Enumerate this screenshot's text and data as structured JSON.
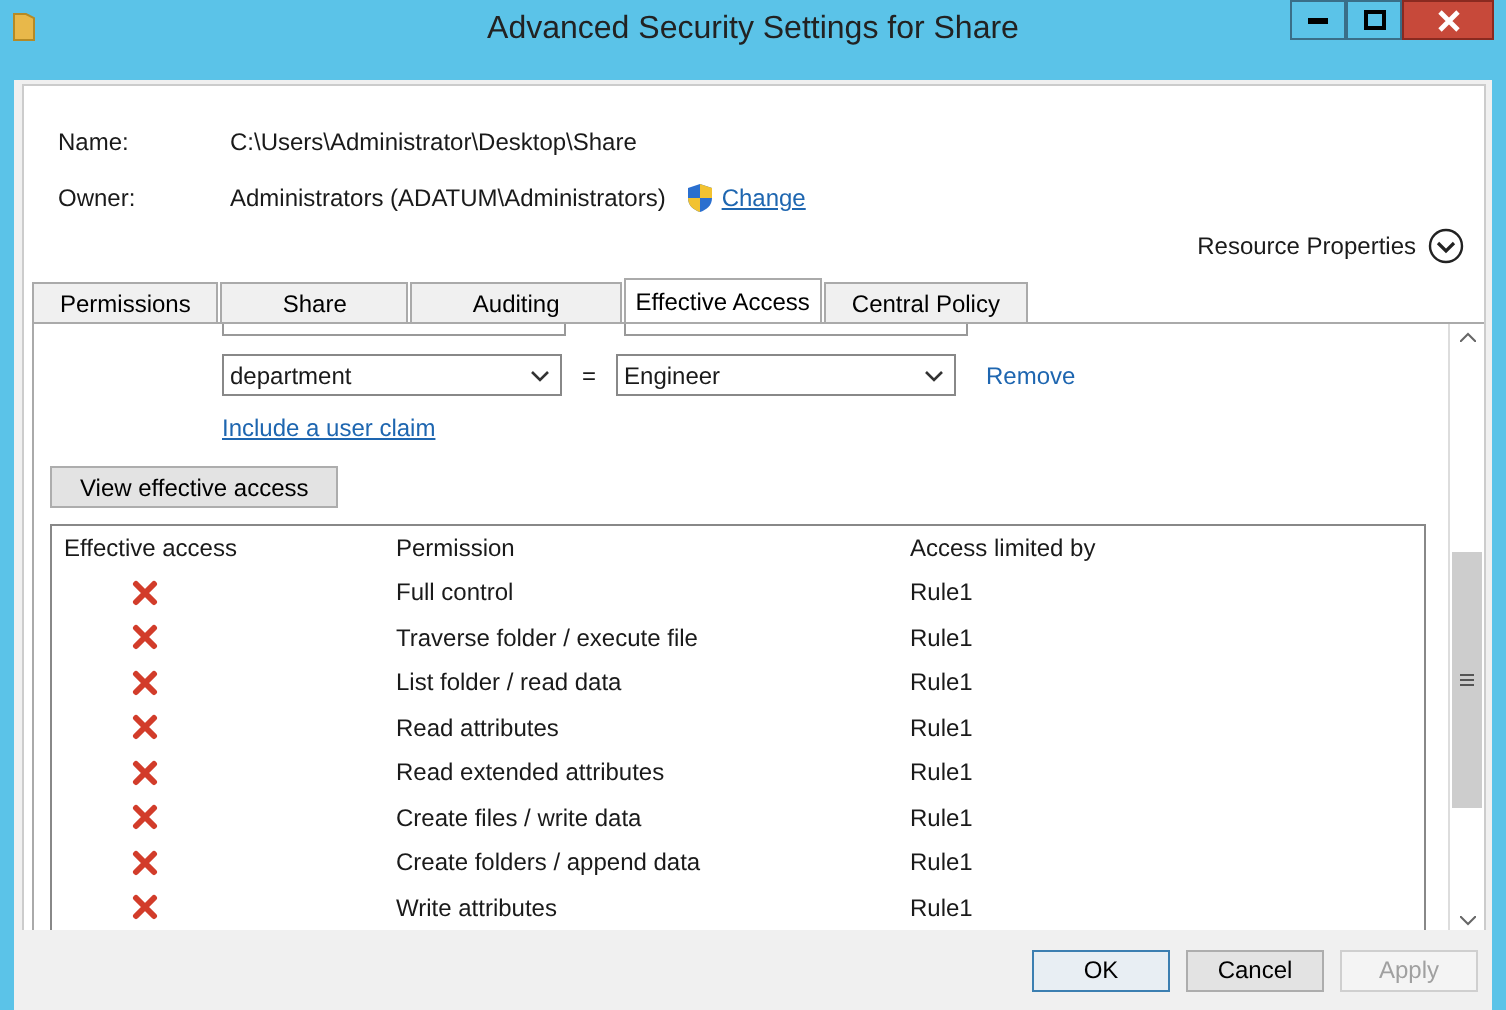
{
  "window": {
    "title": "Advanced Security Settings for Share"
  },
  "details": {
    "name_label": "Name:",
    "name_value": "C:\\Users\\Administrator\\Desktop\\Share",
    "owner_label": "Owner:",
    "owner_value": "Administrators (ADATUM\\Administrators)",
    "change_link": "Change",
    "resource_properties": "Resource Properties"
  },
  "tabs": [
    {
      "label": "Permissions",
      "selected": false
    },
    {
      "label": "Share",
      "selected": false
    },
    {
      "label": "Auditing",
      "selected": false
    },
    {
      "label": "Effective Access",
      "selected": true
    },
    {
      "label": "Central Policy",
      "selected": false
    }
  ],
  "claim": {
    "attribute": "department",
    "operator": "=",
    "value": "Engineer",
    "remove_link": "Remove",
    "include_link": "Include a user claim"
  },
  "view_button": "View effective access",
  "table": {
    "columns": [
      "Effective access",
      "Permission",
      "Access limited by"
    ],
    "rows": [
      {
        "denied": true,
        "permission": "Full control",
        "limited_by": "Rule1"
      },
      {
        "denied": true,
        "permission": "Traverse folder / execute file",
        "limited_by": "Rule1"
      },
      {
        "denied": true,
        "permission": "List folder / read data",
        "limited_by": "Rule1"
      },
      {
        "denied": true,
        "permission": "Read attributes",
        "limited_by": "Rule1"
      },
      {
        "denied": true,
        "permission": "Read extended attributes",
        "limited_by": "Rule1"
      },
      {
        "denied": true,
        "permission": "Create files / write data",
        "limited_by": "Rule1"
      },
      {
        "denied": true,
        "permission": "Create folders / append data",
        "limited_by": "Rule1"
      },
      {
        "denied": true,
        "permission": "Write attributes",
        "limited_by": "Rule1"
      }
    ]
  },
  "buttons": [
    {
      "label": "OK",
      "kind": "default",
      "disabled": false
    },
    {
      "label": "Cancel",
      "kind": "normal",
      "disabled": false
    },
    {
      "label": "Apply",
      "kind": "normal",
      "disabled": true
    }
  ]
}
